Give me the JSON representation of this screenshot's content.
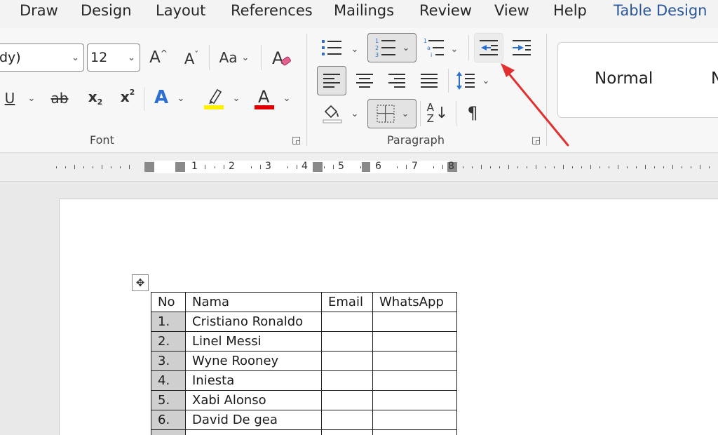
{
  "tabs": [
    "Draw",
    "Design",
    "Layout",
    "References",
    "Mailings",
    "Review",
    "View",
    "Help",
    "Table Design"
  ],
  "active_tab": "Table Design",
  "font": {
    "font_name": "dy)",
    "font_size": "12",
    "grow": "A",
    "shrink": "A",
    "change_case": "Aa",
    "underline": "U",
    "strikethrough": "ab",
    "subscript": "x",
    "subscript_mark": "2",
    "superscript": "x",
    "superscript_mark": "2",
    "text_effects": "A",
    "font_color": "A",
    "highlight_color": "#ffef00",
    "text_color": "#e00000",
    "group_label": "Font"
  },
  "paragraph": {
    "sort_top": "A",
    "sort_bottom": "Z",
    "pilcrow": "¶",
    "group_label": "Paragraph"
  },
  "styles": {
    "normal": "Normal",
    "next": "N"
  },
  "ruler": [
    "1",
    "2",
    "3",
    "4",
    "5",
    "6",
    "7",
    "8"
  ],
  "table": {
    "headers": [
      "No",
      "Nama",
      "Email",
      "WhatsApp"
    ],
    "rows": [
      [
        "1.",
        "Cristiano Ronaldo",
        "",
        ""
      ],
      [
        "2.",
        "Linel Messi",
        "",
        ""
      ],
      [
        "3.",
        "Wyne Rooney",
        "",
        ""
      ],
      [
        "4.",
        "Iniesta",
        "",
        ""
      ],
      [
        "5.",
        "Xabi Alonso",
        "",
        ""
      ],
      [
        "6.",
        "David De gea",
        "",
        ""
      ],
      [
        "",
        "",
        "",
        ""
      ]
    ]
  },
  "annotation_color": "#e03030",
  "icons": {
    "bullets": "bullets-icon",
    "numbering": "numbering-icon",
    "multilevel": "multilevel-list-icon",
    "decrease_indent": "decrease-indent-icon",
    "increase_indent": "increase-indent-icon",
    "move_handle": "table-move-handle-icon"
  }
}
